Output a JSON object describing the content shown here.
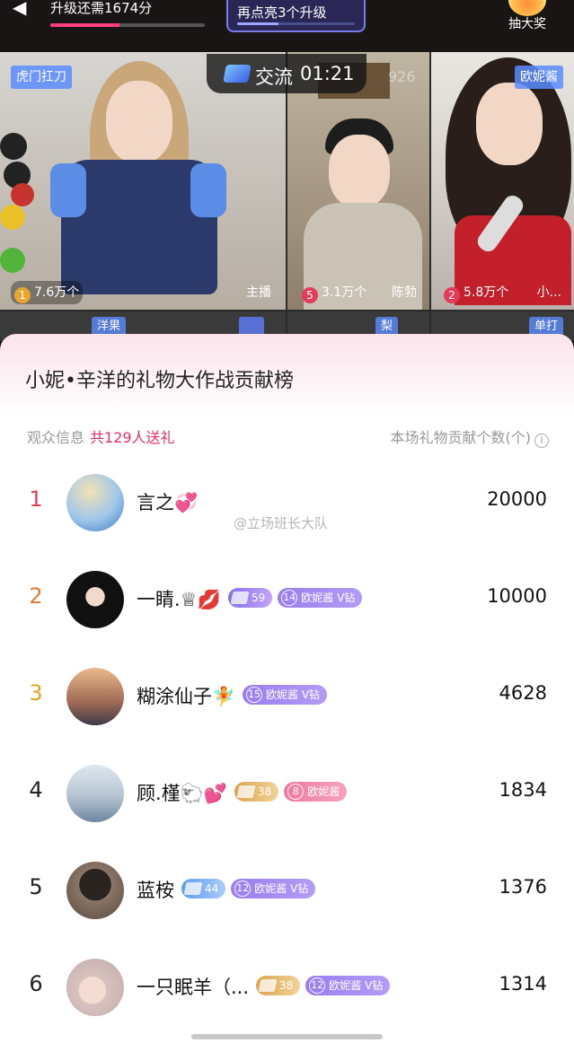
{
  "topbar": {
    "upgrade_text": "升级还需1674分",
    "upgrade_progress": 0.45,
    "relight_text": "再点亮3个升级",
    "lottery_label": "抽大奖"
  },
  "session": {
    "label": "交流",
    "timer": "01:21",
    "ghost_number": "926"
  },
  "tiles": [
    {
      "tag": "虎门扛刀",
      "rank": "1",
      "count": "7.6万个",
      "role": "主播"
    },
    {
      "rank": "5",
      "count": "3.1万个",
      "name": "陈勃"
    },
    {
      "tag": "欧妮酱",
      "rank": "2",
      "count": "5.8万个",
      "name": "小..."
    }
  ],
  "row2_tags": [
    "洋果",
    "梨",
    "单打"
  ],
  "sheet": {
    "title": "小妮•辛洋的礼物大作战贡献榜",
    "audience_label": "观众信息",
    "audience_count": "共129人送礼",
    "contribution_label": "本场礼物贡献个数(个)",
    "info_glyph": "i"
  },
  "watermark": "@立场班长大队",
  "leaderboard": [
    {
      "rank": "1",
      "name": "言之💞",
      "value": "20000",
      "rank_color": "#e0405f",
      "badges": []
    },
    {
      "rank": "2",
      "name": "一睛.♕💋",
      "value": "10000",
      "rank_color": "#e07a35",
      "badges": [
        {
          "type": "gem",
          "style": "gem-purple",
          "level": "59"
        },
        {
          "type": "fan",
          "style": "fan",
          "level": "14",
          "label": "欧妮酱 V钻"
        }
      ]
    },
    {
      "rank": "3",
      "name": "糊涂仙子🧚",
      "value": "4628",
      "rank_color": "#e0a526",
      "badges": [
        {
          "type": "fan",
          "style": "fan",
          "level": "15",
          "label": "欧妮酱 V钻"
        }
      ]
    },
    {
      "rank": "4",
      "name": "顾.槿🐑💕",
      "value": "1834",
      "rank_color": "#222222",
      "badges": [
        {
          "type": "gem",
          "style": "gem-gold",
          "level": "38"
        },
        {
          "type": "fan",
          "style": "fan-pink",
          "level": "8",
          "label": "欧妮酱"
        }
      ]
    },
    {
      "rank": "5",
      "name": "蓝桉",
      "value": "1376",
      "rank_color": "#222222",
      "badges": [
        {
          "type": "gem",
          "style": "gem-blue",
          "level": "44"
        },
        {
          "type": "fan",
          "style": "fan",
          "level": "12",
          "label": "欧妮酱 V钻"
        }
      ]
    },
    {
      "rank": "6",
      "name": "一只眠羊（...",
      "value": "1314",
      "rank_color": "#222222",
      "badges": [
        {
          "type": "gem",
          "style": "gem-gold",
          "level": "38"
        },
        {
          "type": "fan",
          "style": "fan",
          "level": "12",
          "label": "欧妮酱 V钻"
        }
      ]
    }
  ]
}
